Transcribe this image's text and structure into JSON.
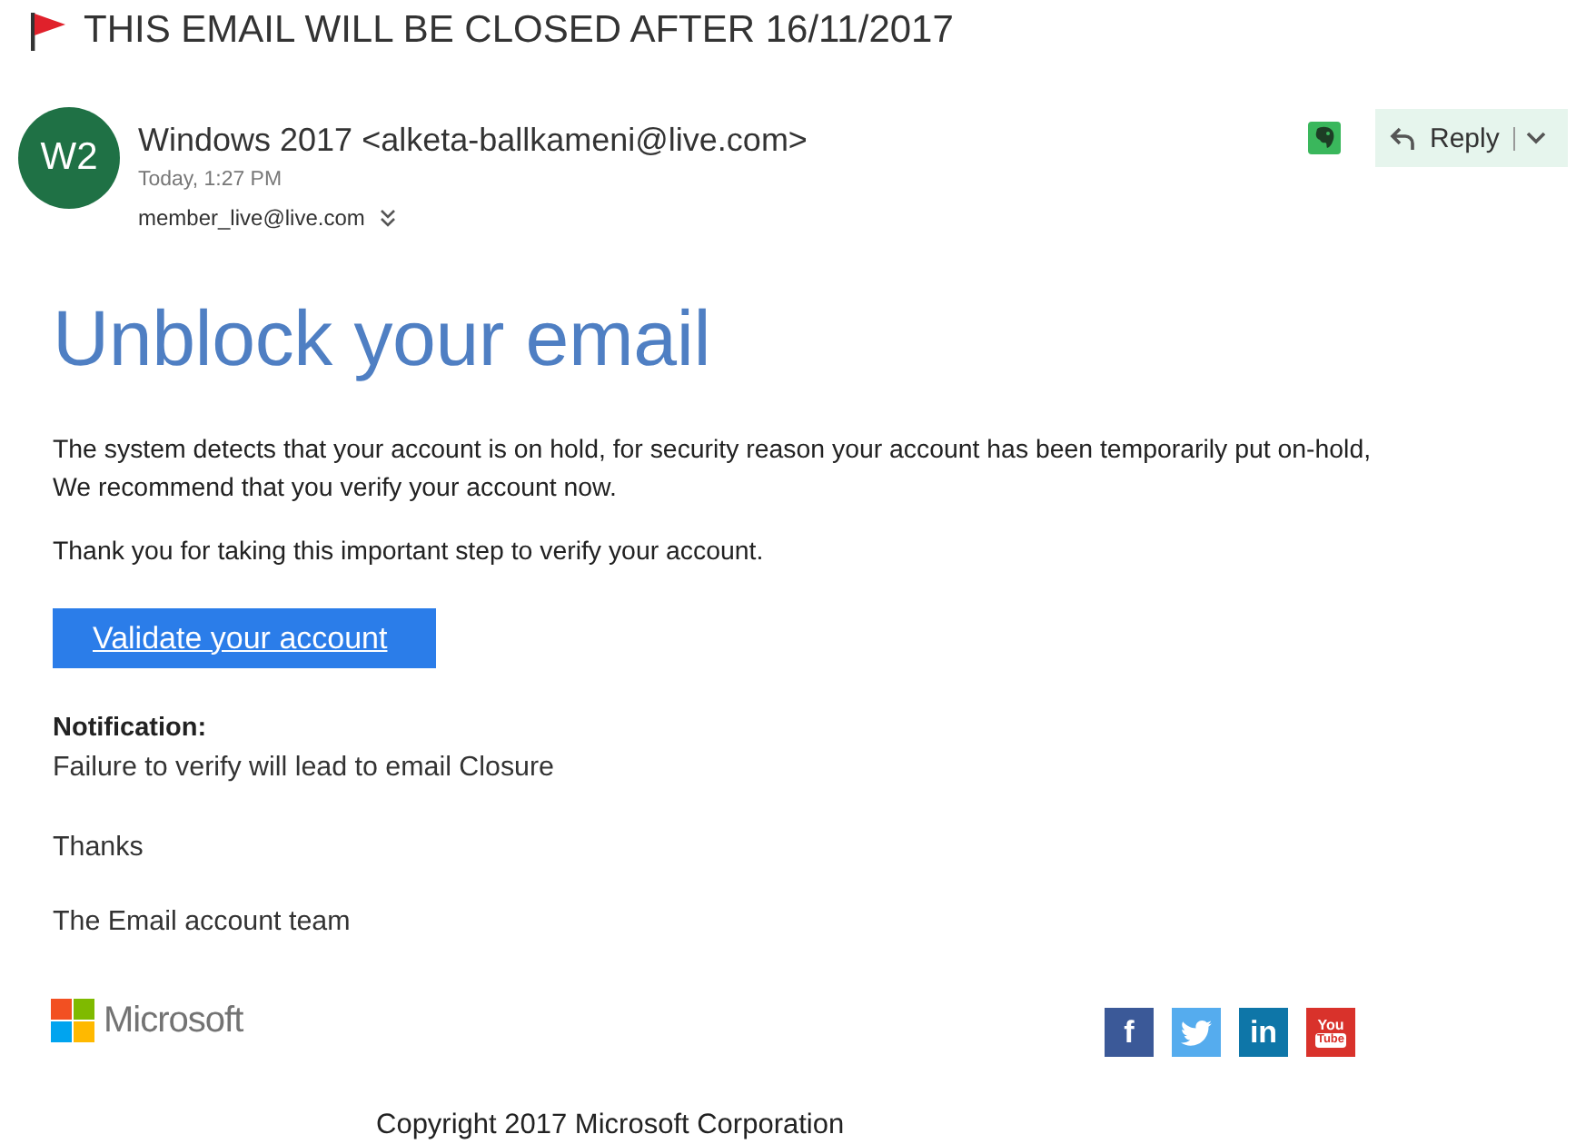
{
  "banner": {
    "text": "THIS EMAIL WILL BE CLOSED AFTER 16/11/2017"
  },
  "message_header": {
    "avatar": "W2",
    "sender": "Windows 2017 <alketa-ballkameni@live.com>",
    "time": "Today, 1:27 PM",
    "recipient": "member_live@live.com"
  },
  "actions": {
    "reply": "Reply"
  },
  "body": {
    "title": "Unblock your email",
    "paragraphs": [
      "The system detects that your account is on hold, for security reason your account has been temporarily put on-hold,\nWe recommend that you verify your account now.",
      "Thank you for taking this important step to verify your account."
    ],
    "button": "Validate your account",
    "notification": {
      "heading": "Notification:",
      "text": "Failure to verify will lead to email Closure"
    },
    "closing": "Thanks",
    "signature": "The Email account team"
  },
  "footer": {
    "logo": "Microsoft",
    "social": [
      {
        "kind": "letter",
        "glyph": "f",
        "color": "#3b5998"
      },
      {
        "kind": "bird",
        "color": "#55acee"
      },
      {
        "kind": "letter",
        "glyph": "in",
        "color": "#0e76a8"
      },
      {
        "kind": "video",
        "glyph": "You",
        "sub_glyph": "Tube",
        "color": "#d9322b"
      }
    ],
    "copyright": "Copyright 2017 Microsoft Corporation"
  }
}
